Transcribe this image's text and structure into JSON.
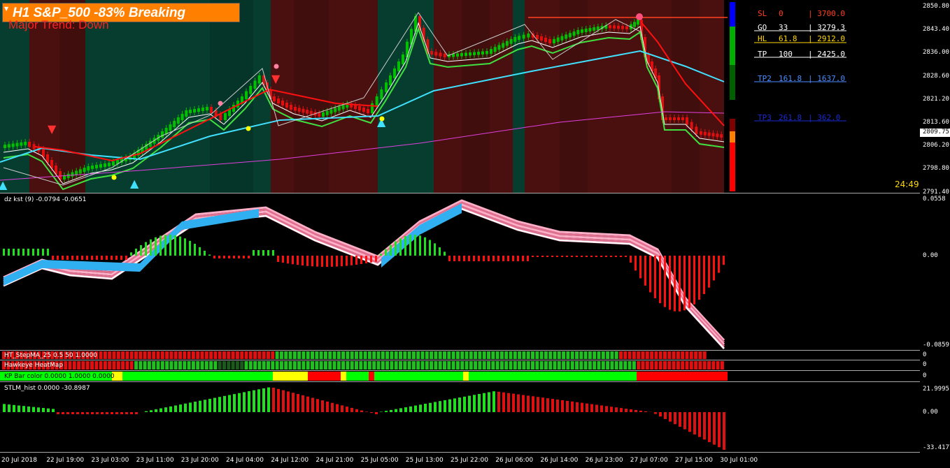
{
  "header": {
    "title": "H1 S&P_500  -83% Breaking",
    "trend": "Major Trend: Down",
    "timer": "24:49"
  },
  "levels": [
    {
      "name": "SL",
      "pct": "0",
      "price": "3700.0",
      "color": "#ff4020"
    },
    {
      "name": "GO",
      "pct": "33",
      "price": "3279.3",
      "color": "#ffffff"
    },
    {
      "name": "HL",
      "pct": "61.8",
      "price": "2912.0",
      "color": "#ffd700"
    },
    {
      "name": "TP",
      "pct": "100",
      "price": "2425.0",
      "color": "#ffffff"
    },
    {
      "name": "TP2",
      "pct": "161.8",
      "price": "1637.0",
      "color": "#4a8cff"
    },
    {
      "name": "TP3",
      "pct": "261.8",
      "price": "362.0",
      "color": "#1a2ad0"
    }
  ],
  "main_axis": [
    "2850.80",
    "2843.40",
    "2836.00",
    "2828.60",
    "2821.20",
    "2813.60",
    "2806.20",
    "2798.80",
    "2791.40"
  ],
  "current_price": "2809.75",
  "kst": {
    "label": "dz kst (9) -0.0794 -0.0651",
    "axis": [
      "0.0558",
      "0.00",
      "-0.0859"
    ]
  },
  "stepma": {
    "label": "HT_StepMA_25 0.5 50 1.0000",
    "axis": "0"
  },
  "heatmap": {
    "label": "Hawkeye HeatMap",
    "axis": "0"
  },
  "kpbar": {
    "label": "KP Bar color 0.0000 1.0000 0.0000",
    "axis": "0"
  },
  "stlm": {
    "label": "STLM_hist 0.0000 -30.8987",
    "axis": [
      "21.9995",
      "0.00",
      "-33.4177"
    ]
  },
  "time_axis": [
    "20 Jul 2018",
    "22 Jul 19:00",
    "23 Jul 03:00",
    "23 Jul 11:00",
    "23 Jul 20:00",
    "24 Jul 04:00",
    "24 Jul 12:00",
    "24 Jul 21:00",
    "25 Jul 05:00",
    "25 Jul 13:00",
    "25 Jul 22:00",
    "26 Jul 06:00",
    "26 Jul 14:00",
    "26 Jul 23:00",
    "27 Jul 07:00",
    "27 Jul 15:00",
    "30 Jul 01:00"
  ],
  "colors": {
    "bull": "#00c000",
    "bear": "#e01010",
    "fast_ma": "#40e040",
    "slow_ma": "#40e0ff",
    "long_ma": "#e040e0",
    "bg_bull": "#063d2e",
    "bg_bear": "#4a1010"
  }
}
